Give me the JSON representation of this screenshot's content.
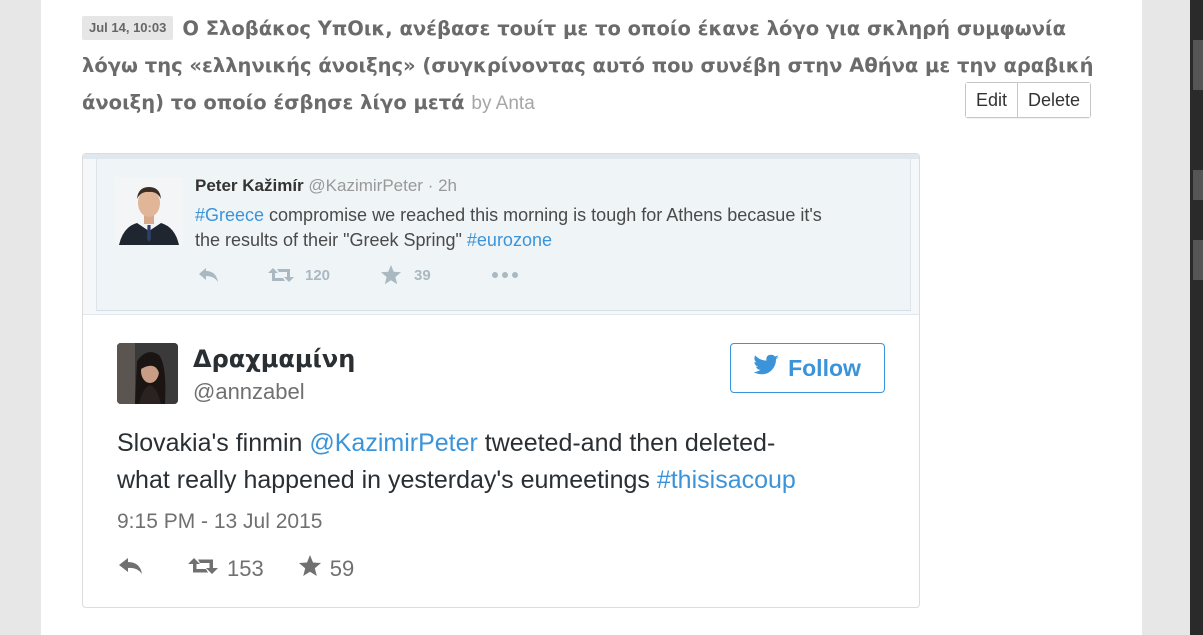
{
  "post": {
    "timestamp": "Jul 14, 10:03",
    "title_line1": "Ο Σλοβάκος ΥπΟικ, ανέβασε τουίτ με το οποίο έκανε λόγο για σκληρή συμφωνία",
    "title_line2": "λόγω της «ελληνικής άνοιξης» (συγκρίνοντας αυτό που συνέβη στην Αθήνα με την αραβική",
    "title_line3": "άνοιξη) το οποίο έσβησε λίγο μετά",
    "byline": "by Anta",
    "edit_label": "Edit",
    "delete_label": "Delete"
  },
  "quoted_tweet": {
    "name": "Peter Kažimír",
    "handle": "@KazimirPeter",
    "time": "· 2h",
    "hashtag1": "#Greece",
    "text_part1": " compromise we reached this morning is tough for Athens becasue it's",
    "text_part2": "the results of their  \"Greek Spring\" ",
    "hashtag2": "#eurozone",
    "retweets": "120",
    "favorites": "39"
  },
  "tweet": {
    "name": "Δραχμαμίνη",
    "handle": "@annzabel",
    "follow_label": "Follow",
    "text_part1": "Slovakia's finmin ",
    "mention": "@KazimirPeter",
    "text_part2": " tweeted-and then deleted-",
    "text_part3": "what really happened in yesterday's eumeetings ",
    "hashtag": "#thisisacoup",
    "date": "9:15 PM - 13 Jul 2015",
    "retweets": "153",
    "favorites": "59"
  },
  "colors": {
    "link_blue": "#3b94d9",
    "title_gray": "#6b6b6b",
    "byline_gray": "#a6a6a6"
  }
}
